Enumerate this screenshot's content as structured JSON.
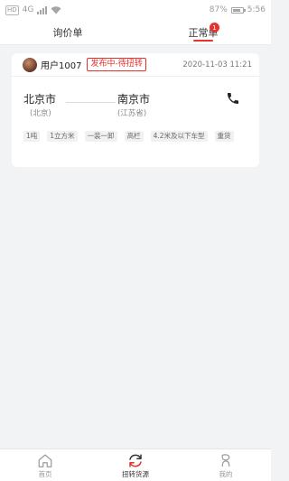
{
  "status_bar": {
    "left_chip": "HD",
    "network": "4G",
    "battery": "87%",
    "battery_level": 0.87,
    "time": "5:56"
  },
  "tabs": [
    {
      "label": "询价单",
      "active": false
    },
    {
      "label": "正常单",
      "active": true,
      "badge": "1"
    }
  ],
  "order_card": {
    "username": "用户1007",
    "status": "发布中-待扭转",
    "timestamp": "2020-11-03 11:21",
    "origin": {
      "city": "北京市",
      "region": "(北京)"
    },
    "destination": {
      "city": "南京市",
      "region": "(江苏省)"
    },
    "tags": [
      "1吨",
      "1立方米",
      "一装一卸",
      "高栏",
      "4.2米及以下车型",
      "重货"
    ]
  },
  "bottom_nav": [
    {
      "label": "首页",
      "icon": "home-icon",
      "active": false
    },
    {
      "label": "扭转货源",
      "icon": "refresh-icon",
      "active": true
    },
    {
      "label": "我的",
      "icon": "person-icon",
      "active": false
    }
  ],
  "colors": {
    "accent": "#e5322d",
    "background": "#f2f3f5"
  }
}
